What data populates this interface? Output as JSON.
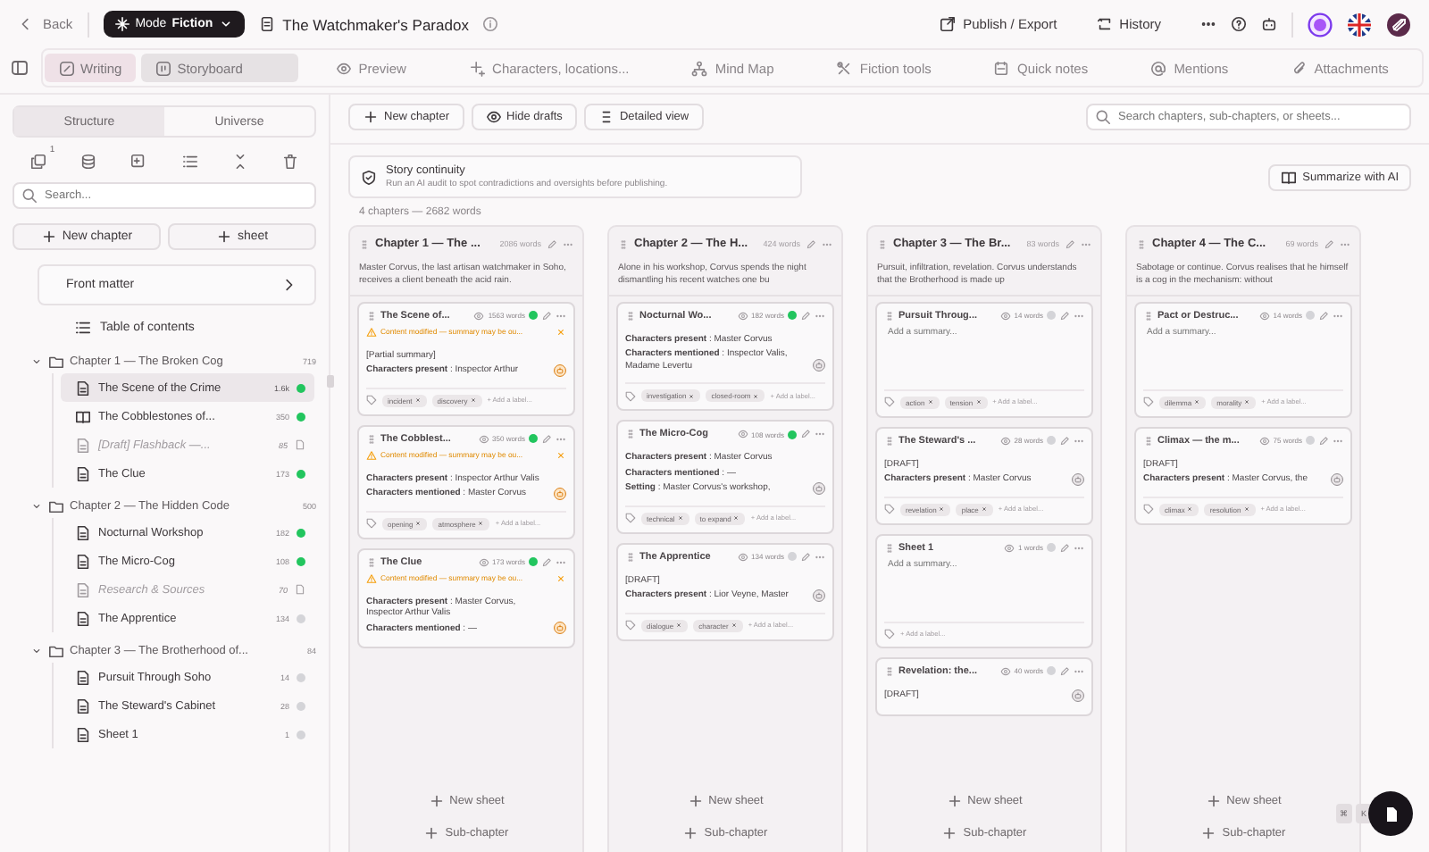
{
  "header": {
    "back": "Back",
    "mode_label": "Mode",
    "mode_value": "Fiction",
    "title": "The Watchmaker's Paradox",
    "actions": [
      {
        "label": "Publish / Export",
        "kind": "export"
      },
      {
        "label": "History",
        "kind": "history"
      }
    ]
  },
  "mode_tabs": [
    {
      "label": "Writing",
      "selected": true,
      "kind": "pen"
    },
    {
      "label": "Storyboard",
      "selected": true,
      "kind": "board"
    }
  ],
  "nav_tabs": [
    {
      "label": "Preview",
      "kind": "eye"
    },
    {
      "label": "Characters, locations...",
      "kind": "sparkle"
    },
    {
      "label": "Mind Map",
      "kind": "tree"
    },
    {
      "label": "Fiction tools",
      "kind": "tools"
    },
    {
      "label": "Quick notes",
      "kind": "note"
    },
    {
      "label": "Mentions",
      "kind": "at"
    },
    {
      "label": "Attachments",
      "kind": "clip"
    }
  ],
  "sidebar": {
    "segments": [
      {
        "label": "Structure",
        "selected": true
      },
      {
        "label": "Universe",
        "selected": false
      }
    ],
    "tool_badge": "1",
    "search": {
      "placeholder": "Search..."
    },
    "buttons": [
      "New chapter",
      "sheet"
    ],
    "front_matter": "Front matter",
    "toc": "Table of contents",
    "tree": [
      {
        "title": "Chapter 1 — The Broken Cog",
        "count": "719",
        "expanded": true,
        "children": [
          {
            "title": "The Scene of the Crime",
            "count": "1.6k",
            "kind": "sheet",
            "color": "#22c55e",
            "selected": true
          },
          {
            "title": "The Cobblestones of...",
            "count": "350",
            "kind": "book",
            "color": "#22c55e",
            "selected": false
          },
          {
            "title": "[Draft] Flashback —...",
            "count": "85",
            "kind": "draft",
            "selected": false
          },
          {
            "title": "The Clue",
            "count": "173",
            "kind": "sheet",
            "color": "#22c55e",
            "selected": false
          }
        ]
      },
      {
        "title": "Chapter 2 — The Hidden Code",
        "count": "500",
        "expanded": true,
        "children": [
          {
            "title": "Nocturnal Workshop",
            "count": "182",
            "kind": "sheet",
            "color": "#22c55e",
            "selected": false
          },
          {
            "title": "The Micro-Cog",
            "count": "108",
            "kind": "sheet",
            "color": "#22c55e",
            "selected": false
          },
          {
            "title": "Research & Sources",
            "count": "70",
            "kind": "draft",
            "selected": false
          },
          {
            "title": "The Apprentice",
            "count": "134",
            "kind": "sheet",
            "color": "#d4d4d8",
            "selected": false
          }
        ]
      },
      {
        "title": "Chapter 3 — The Brotherhood of...",
        "count": "84",
        "expanded": true,
        "children": [
          {
            "title": "Pursuit Through Soho",
            "count": "14",
            "kind": "sheet",
            "color": "#d4d4d8",
            "selected": false
          },
          {
            "title": "The Steward's Cabinet",
            "count": "28",
            "kind": "sheet",
            "color": "#d4d4d8",
            "selected": false
          },
          {
            "title": "Sheet 1",
            "count": "1",
            "kind": "sheet",
            "color": "#d4d4d8",
            "selected": false
          }
        ]
      }
    ]
  },
  "toolbar": {
    "buttons": [
      {
        "label": "New chapter",
        "kind": "plus"
      },
      {
        "label": "Hide drafts",
        "kind": "eye"
      },
      {
        "label": "Detailed view",
        "kind": "list"
      }
    ],
    "search": {
      "placeholder": "Search chapters, sub-chapters, or sheets..."
    }
  },
  "continuity": {
    "title": "Story continuity",
    "text": "Run an AI audit to spot contradictions and oversights before publishing.",
    "button": "Summarize with AI"
  },
  "summary": "4 chapters — 2682 words",
  "chapters": [
    {
      "title": "Chapter 1 — The ...",
      "words": "2086 words",
      "synopsis": "Master Corvus, the last artisan watchmaker in Soho, receives a client beneath the acid rain.",
      "new_sheet": "New sheet",
      "sub_chapter": "Sub-chapter",
      "sheets": [
        {
          "title": "The Scene of...",
          "words": "1563 words",
          "color": "#22c55e",
          "warning": "Content modified — summary may be ou...",
          "lines": [
            "[Partial summary]",
            "**Characters present** : Inspector Arthur"
          ],
          "tags": [
            "incident",
            "discovery"
          ],
          "add_label": "+ Add a label..."
        },
        {
          "title": "The Cobblest...",
          "words": "350 words",
          "color": "#22c55e",
          "warning": "Content modified — summary may be ou...",
          "lines": [
            "**Characters present** : Inspector Arthur Valis",
            "**Characters mentioned** : Master Corvus"
          ],
          "tags": [
            "opening",
            "atmosphere"
          ],
          "add_label": "+ Add a label..."
        },
        {
          "title": "The Clue",
          "words": "173 words",
          "color": "#22c55e",
          "warning": "Content modified — summary may be ou...",
          "lines": [
            "**Characters present** : Master Corvus, Inspector Arthur Valis",
            "**Characters mentioned** : —"
          ]
        }
      ]
    },
    {
      "title": "Chapter 2 — The H...",
      "words": "424 words",
      "synopsis": "Alone in his workshop, Corvus spends the night dismantling his recent watches one bu",
      "new_sheet": "New sheet",
      "sub_chapter": "Sub-chapter",
      "sheets": [
        {
          "title": "Nocturnal Wo...",
          "words": "182 words",
          "color": "#22c55e",
          "lines": [
            "**Characters present** : Master Corvus",
            "**Characters mentioned** : Inspector Valis, Madame Levertu"
          ],
          "tags": [
            "investigation",
            "closed-room"
          ],
          "add_label": "+ Add a label..."
        },
        {
          "title": "The Micro-Cog",
          "words": "108 words",
          "color": "#22c55e",
          "lines": [
            "**Characters present** : Master Corvus",
            "**Characters mentioned** : —",
            "**Setting** : Master Corvus's workshop,"
          ],
          "tags": [
            "technical",
            "to expand"
          ],
          "add_label": "+ Add a label..."
        },
        {
          "title": "The Apprentice",
          "words": "134 words",
          "color": "#d4d4d8",
          "lines": [
            "[DRAFT]",
            "**Characters present** : Lior Veyne, Master"
          ],
          "tags": [
            "dialogue",
            "character"
          ],
          "add_label": "+ Add a label..."
        }
      ]
    },
    {
      "title": "Chapter 3 — The Br...",
      "words": "83 words",
      "synopsis": "Pursuit, infiltration, revelation. Corvus understands that the Brotherhood is made up",
      "new_sheet": "New sheet",
      "sub_chapter": "Sub-chapter",
      "sheets": [
        {
          "title": "Pursuit Throug...",
          "words": "14 words",
          "color": "#d4d4d8",
          "placeholder": "Add a summary...",
          "tags": [
            "action",
            "tension"
          ],
          "add_label": "+ Add a label..."
        },
        {
          "title": "The Steward's ...",
          "words": "28 words",
          "color": "#d4d4d8",
          "lines": [
            "[DRAFT]",
            "**Characters present** : Master Corvus"
          ],
          "tags": [
            "revelation",
            "place"
          ],
          "add_label": "+ Add a label..."
        },
        {
          "title": "Sheet 1",
          "words": "1 words",
          "color": "#d4d4d8",
          "placeholder": "Add a summary...",
          "add_label": "+ Add a label..."
        },
        {
          "title": "Revelation: the...",
          "words": "40 words",
          "color": "#d4d4d8",
          "lines": [
            "[DRAFT]"
          ]
        }
      ]
    },
    {
      "title": "Chapter 4 — The C...",
      "words": "69 words",
      "synopsis": "Sabotage or continue. Corvus realises that he himself is a cog in the mechanism: without",
      "new_sheet": "New sheet",
      "sub_chapter": "Sub-chapter",
      "sheets": [
        {
          "title": "Pact or Destruc...",
          "words": "14 words",
          "color": "#d4d4d8",
          "placeholder": "Add a summary...",
          "tags": [
            "dilemma",
            "morality"
          ],
          "add_label": "+ Add a label..."
        },
        {
          "title": "Climax — the m...",
          "words": "75 words",
          "color": "#d4d4d8",
          "lines": [
            "[DRAFT]",
            "**Characters present** : Master Corvus, the"
          ],
          "tags": [
            "climax",
            "resolution"
          ],
          "add_label": "+ Add a label..."
        }
      ]
    }
  ],
  "shortcut": [
    "⌘",
    "K"
  ]
}
